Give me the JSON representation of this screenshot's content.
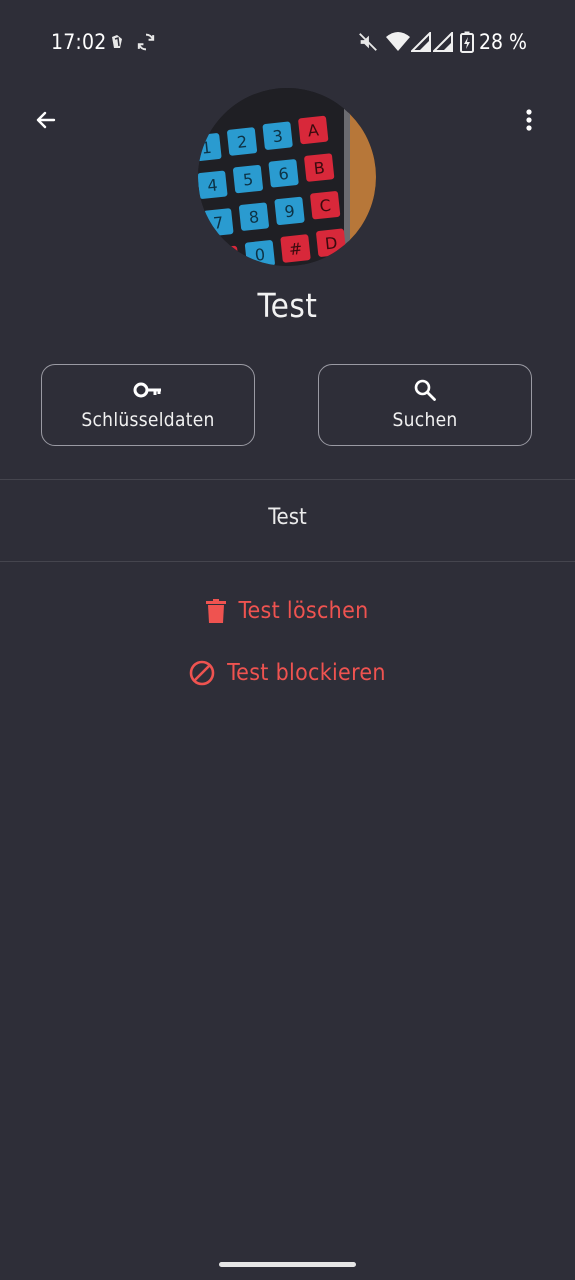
{
  "status_bar": {
    "time": "17:02",
    "battery": "28 %",
    "icons": [
      "notification-icon",
      "sync-icon",
      "vibrate-off-icon",
      "wifi-icon",
      "signal-icon",
      "signal-icon",
      "battery-charging-icon"
    ]
  },
  "header": {
    "back_icon": "arrow-back-icon",
    "menu_icon": "more-vert-icon"
  },
  "profile": {
    "name": "Test",
    "avatar": "keypad-photo"
  },
  "actions": [
    {
      "label": "Schlüsseldaten",
      "icon": "key-icon"
    },
    {
      "label": "Suchen",
      "icon": "search-icon"
    }
  ],
  "chat": {
    "name": "Test"
  },
  "danger_actions": {
    "delete": {
      "label": "Test löschen",
      "icon": "delete-icon"
    },
    "block": {
      "label": "Test blockieren",
      "icon": "block-icon"
    }
  },
  "colors": {
    "background": "#2e2e38",
    "danger": "#ef5350",
    "text": "#ffffff"
  }
}
